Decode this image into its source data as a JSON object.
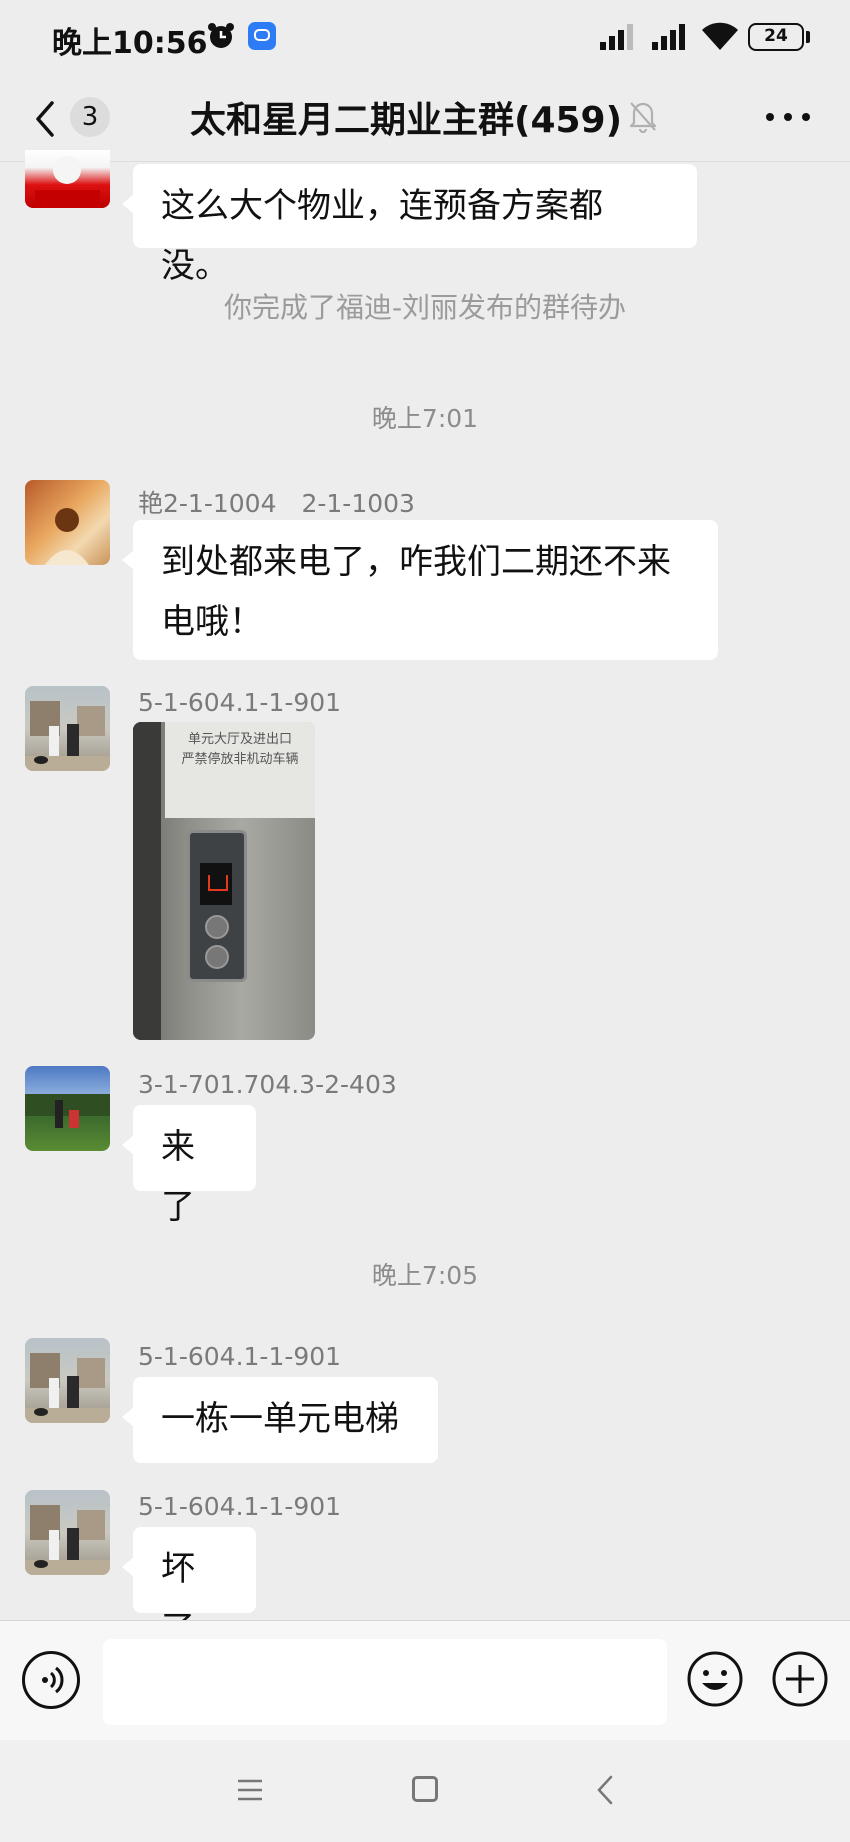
{
  "status_bar": {
    "time": "晚上10:56",
    "battery": "24",
    "icons": [
      "alarm-icon",
      "app-notification-icon",
      "signal-icon",
      "signal-icon",
      "wifi-icon",
      "battery-icon"
    ]
  },
  "header": {
    "unread_count": "3",
    "title": "太和星月二期业主群(459)",
    "icons": [
      "back-icon",
      "mute-icon",
      "more-icon"
    ]
  },
  "messages": {
    "top_bubble": "这么大个物业，连预备方案都没。",
    "system_notice": "你完成了福迪-刘丽发布的群待办",
    "time_1": "晚上7:01",
    "msg1_sender": "艳2-1-1004　2-1-1003",
    "msg1_text_line1": "到处都来电了，咋我们二期还不来",
    "msg1_text_line2": "电哦！",
    "msg2_sender": "5-1-604.1-1-901",
    "msg2_image_sign_line1": "单元大厅及进出口",
    "msg2_image_sign_line2": "严禁停放非机动车辆",
    "msg3_sender": "3-1-701.704.3-2-403",
    "msg3_text": "来了",
    "time_2": "晚上7:05",
    "msg4_sender": "5-1-604.1-1-901",
    "msg4_text": "一栋一单元电梯",
    "msg5_sender": "5-1-604.1-1-901",
    "msg5_text": "坏了"
  },
  "input_bar": {
    "placeholder": "",
    "icons": [
      "voice-icon",
      "emoji-icon",
      "plus-icon"
    ]
  },
  "nav_bar": {
    "icons": [
      "menu-icon",
      "home-icon",
      "back-nav-icon"
    ]
  },
  "colors": {
    "background": "#ededed",
    "bubble": "#ffffff",
    "text": "#111111",
    "muted_text": "#8c8c8c"
  }
}
